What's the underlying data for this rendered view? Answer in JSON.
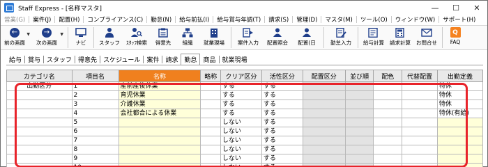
{
  "window": {
    "title": "Staff Express - [名称マスタ]"
  },
  "menu": [
    {
      "label": "営業(G)",
      "disabled": true
    },
    {
      "label": "案件(J)",
      "disabled": false
    },
    {
      "label": "配置(H)",
      "disabled": false
    },
    {
      "label": "コンプライアンス(C)",
      "disabled": false
    },
    {
      "label": "勤怠(N)",
      "disabled": false
    },
    {
      "label": "給与前払(I)",
      "disabled": false
    },
    {
      "label": "給与賞与年調(T)",
      "disabled": false
    },
    {
      "label": "請求(S)",
      "disabled": false
    },
    {
      "label": "管理(D)",
      "disabled": false
    },
    {
      "label": "マスタ(M)",
      "disabled": false
    },
    {
      "label": "ツール(O)",
      "disabled": false
    },
    {
      "label": "ウィンドウ(W)",
      "disabled": false
    },
    {
      "label": "サポート(H)",
      "disabled": false
    }
  ],
  "toolbar": {
    "back": "前の画面",
    "next": "次の画面",
    "navi": "ナビ",
    "staff": "スタッフ",
    "staff_search": "ｽﾀｯﾌ検索",
    "client": "得意先",
    "org": "組織",
    "site": "就業現場",
    "case_input": "案件入力",
    "assign_query": "配置照会",
    "assign_day": "配置(日",
    "attendance_input": "勤怠入力",
    "payroll_calc": "給与計算",
    "billing_calc": "請求計算",
    "contact": "お問合せ",
    "faq": "FAQ",
    "icon_colors": {
      "navy": "#1f3e8a",
      "orange": "#f58220"
    }
  },
  "tabs": [
    "給与",
    "賞与",
    "スタッフ",
    "得意先",
    "スケジュール",
    "案件",
    "請求",
    "勤怠",
    "商品",
    "就業現場"
  ],
  "active_tab": "勤怠",
  "grid": {
    "headers": {
      "category": "カテゴリ名",
      "item": "項目名",
      "name": "名称",
      "abbr": "略称",
      "clear": "クリア区分",
      "active": "活性区分",
      "placement": "配置区分",
      "order": "並び順",
      "color": "配色",
      "alt": "代替配置",
      "definition": "出勤定義"
    },
    "category_value": "出勤区分",
    "rows": [
      {
        "item": "1",
        "name": "産前産後休業",
        "clear": "する",
        "active": "する",
        "definition": "特休"
      },
      {
        "item": "2",
        "name": "育児休業",
        "clear": "する",
        "active": "する",
        "definition": "特休"
      },
      {
        "item": "3",
        "name": "介護休業",
        "clear": "する",
        "active": "する",
        "definition": "特休"
      },
      {
        "item": "4",
        "name": "会社都合による休業",
        "clear": "する",
        "active": "する",
        "definition": "特休(有給)"
      },
      {
        "item": "5",
        "name": "",
        "clear": "しない",
        "active": "する",
        "definition": ""
      },
      {
        "item": "6",
        "name": "",
        "clear": "しない",
        "active": "する",
        "definition": ""
      },
      {
        "item": "7",
        "name": "",
        "clear": "しない",
        "active": "する",
        "definition": ""
      },
      {
        "item": "8",
        "name": "",
        "clear": "しない",
        "active": "する",
        "definition": ""
      },
      {
        "item": "9",
        "name": "",
        "clear": "しない",
        "active": "する",
        "definition": ""
      },
      {
        "item": "10",
        "name": "",
        "clear": "しない",
        "active": "する",
        "definition": ""
      }
    ]
  },
  "colors": {
    "header_accent": "#f0801e",
    "highlight": "#e8232a",
    "editable_bg": "#ffffd9"
  }
}
